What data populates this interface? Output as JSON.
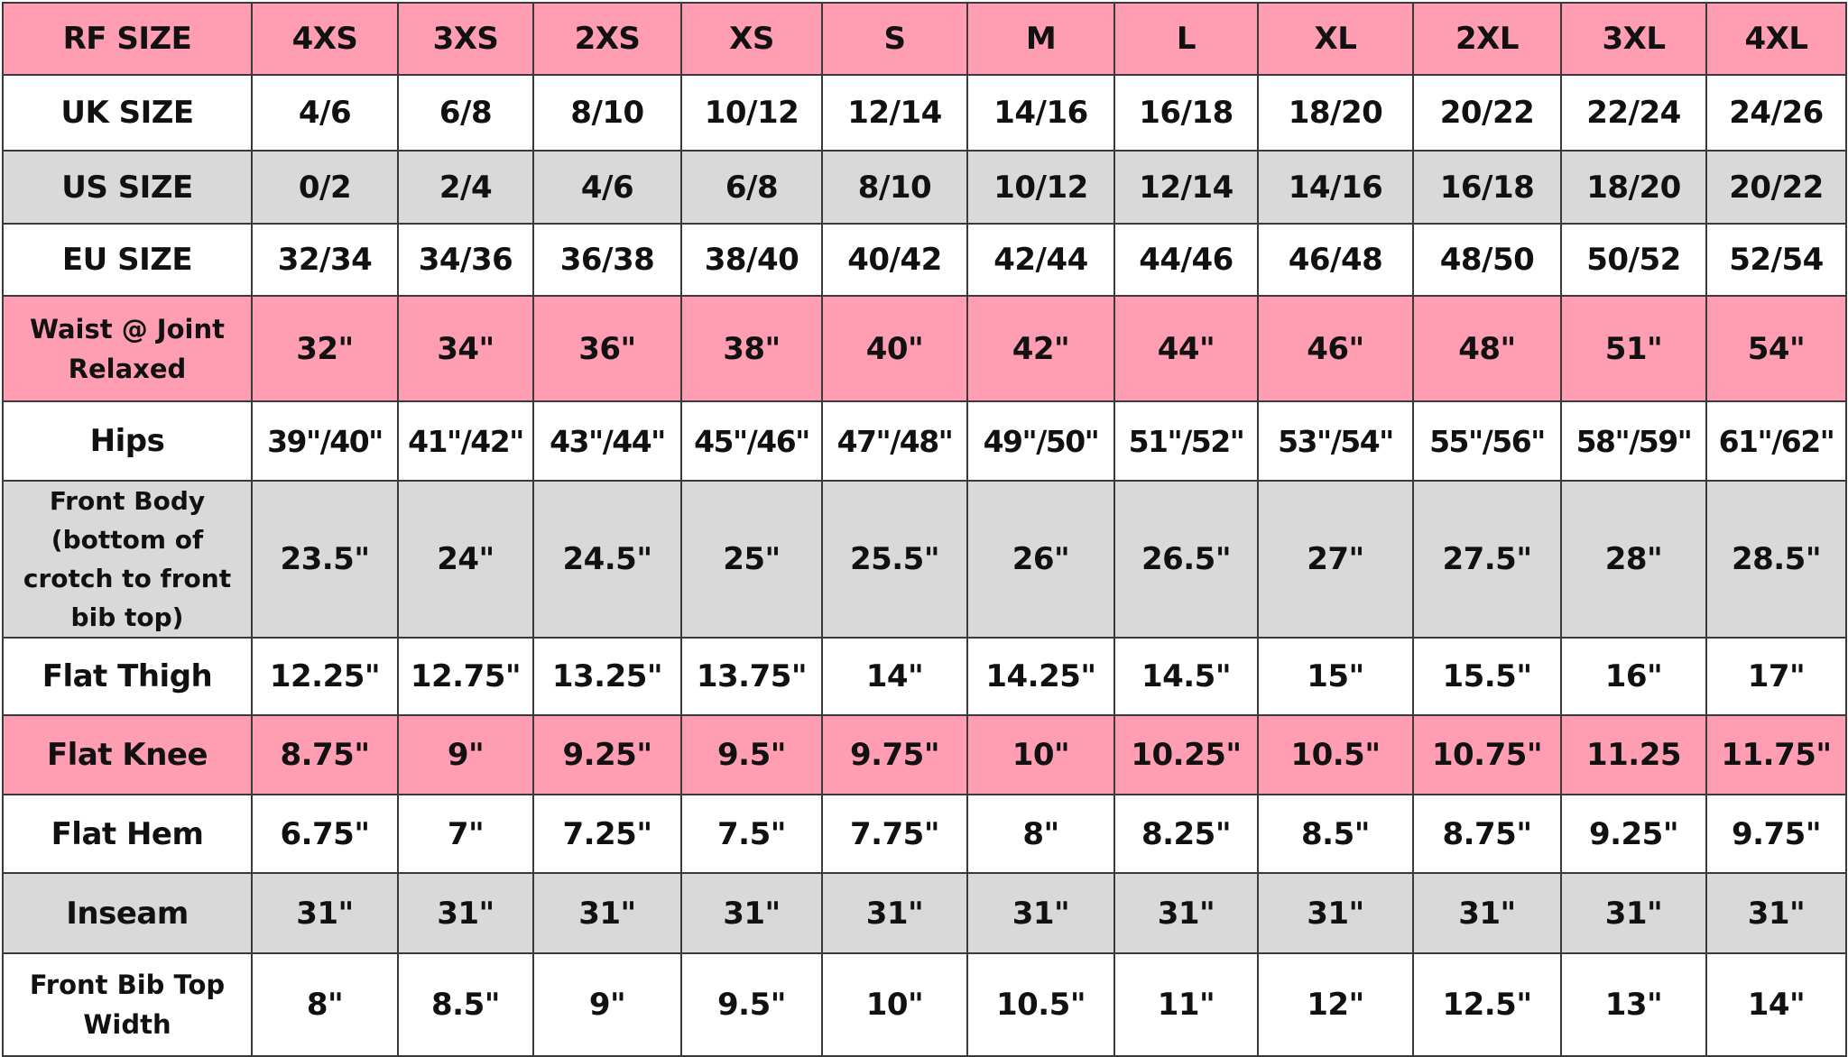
{
  "colors": {
    "pink": "#ff9db3",
    "grey": "#d9d9d9",
    "white": "#ffffff",
    "border": "#3a3a3a"
  },
  "table": {
    "header": {
      "label": "RF SIZE",
      "sizes": [
        "4XS",
        "3XS",
        "2XS",
        "XS",
        "S",
        "M",
        "L",
        "XL",
        "2XL",
        "3XL",
        "4XL"
      ]
    },
    "rows": [
      {
        "label": "UK SIZE",
        "bg": "white",
        "values": [
          "4/6",
          "6/8",
          "8/10",
          "10/12",
          "12/14",
          "14/16",
          "16/18",
          "18/20",
          "20/22",
          "22/24",
          "24/26"
        ]
      },
      {
        "label": "US SIZE",
        "bg": "grey",
        "values": [
          "0/2",
          "2/4",
          "4/6",
          "6/8",
          "8/10",
          "10/12",
          "12/14",
          "14/16",
          "16/18",
          "18/20",
          "20/22"
        ]
      },
      {
        "label": "EU SIZE",
        "bg": "white",
        "values": [
          "32/34",
          "34/36",
          "36/38",
          "38/40",
          "40/42",
          "42/44",
          "44/46",
          "46/48",
          "48/50",
          "50/52",
          "52/54"
        ]
      },
      {
        "label": "Waist @ Joint Relaxed",
        "bg": "pink",
        "values": [
          "32\"",
          "34\"",
          "36\"",
          "38\"",
          "40\"",
          "42\"",
          "44\"",
          "46\"",
          "48\"",
          "51\"",
          "54\""
        ]
      },
      {
        "label": "Hips",
        "bg": "white",
        "values": [
          "39\"/40\"",
          "41\"/42\"",
          "43\"/44\"",
          "45\"/46\"",
          "47\"/48\"",
          "49\"/50\"",
          "51\"/52\"",
          "53\"/54\"",
          "55\"/56\"",
          "58\"/59\"",
          "61\"/62\""
        ]
      },
      {
        "label": "Front Body (bottom of crotch to front bib top)",
        "bg": "grey",
        "values": [
          "23.5\"",
          "24\"",
          "24.5\"",
          "25\"",
          "25.5\"",
          "26\"",
          "26.5\"",
          "27\"",
          "27.5\"",
          "28\"",
          "28.5\""
        ]
      },
      {
        "label": "Flat Thigh",
        "bg": "white",
        "values": [
          "12.25\"",
          "12.75\"",
          "13.25\"",
          "13.75\"",
          "14\"",
          "14.25\"",
          "14.5\"",
          "15\"",
          "15.5\"",
          "16\"",
          "17\""
        ]
      },
      {
        "label": "Flat Knee",
        "bg": "pink",
        "values": [
          "8.75\"",
          "9\"",
          "9.25\"",
          "9.5\"",
          "9.75\"",
          "10\"",
          "10.25\"",
          "10.5\"",
          "10.75\"",
          "11.25",
          "11.75\""
        ]
      },
      {
        "label": "Flat Hem",
        "bg": "white",
        "values": [
          "6.75\"",
          "7\"",
          "7.25\"",
          "7.5\"",
          "7.75\"",
          "8\"",
          "8.25\"",
          "8.5\"",
          "8.75\"",
          "9.25\"",
          "9.75\""
        ]
      },
      {
        "label": "Inseam",
        "bg": "grey",
        "values": [
          "31\"",
          "31\"",
          "31\"",
          "31\"",
          "31\"",
          "31\"",
          "31\"",
          "31\"",
          "31\"",
          "31\"",
          "31\""
        ]
      },
      {
        "label": "Front Bib Top Width",
        "bg": "white",
        "values": [
          "8\"",
          "8.5\"",
          "9\"",
          "9.5\"",
          "10\"",
          "10.5\"",
          "11\"",
          "12\"",
          "12.5\"",
          "13\"",
          "14\""
        ]
      }
    ]
  }
}
